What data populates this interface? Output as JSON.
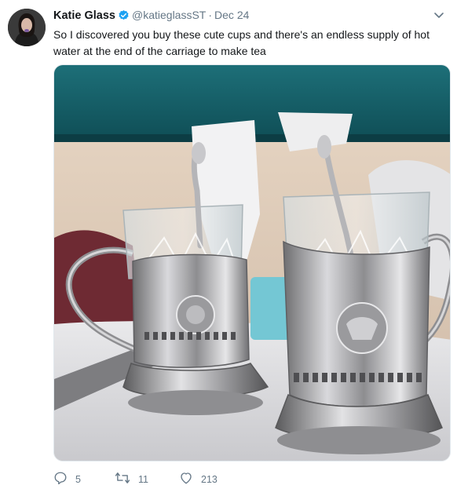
{
  "tweet": {
    "author": {
      "name": "Katie Glass",
      "handle": "@katieglassST",
      "verified": true
    },
    "separator": "·",
    "date": "Dec 24",
    "text": "So I discovered you buy these cute cups and there's an endless supply of hot water at the end of the carriage to make tea",
    "actions": {
      "replies": "5",
      "retweets": "11",
      "likes": "213"
    },
    "icons": {
      "verified": "verified-badge-icon",
      "menu": "chevron-down-icon",
      "reply": "reply-icon",
      "retweet": "retweet-icon",
      "like": "heart-icon"
    },
    "colors": {
      "verified": "#1da1f2",
      "meta_text": "#657786",
      "body_text": "#14171a"
    }
  }
}
